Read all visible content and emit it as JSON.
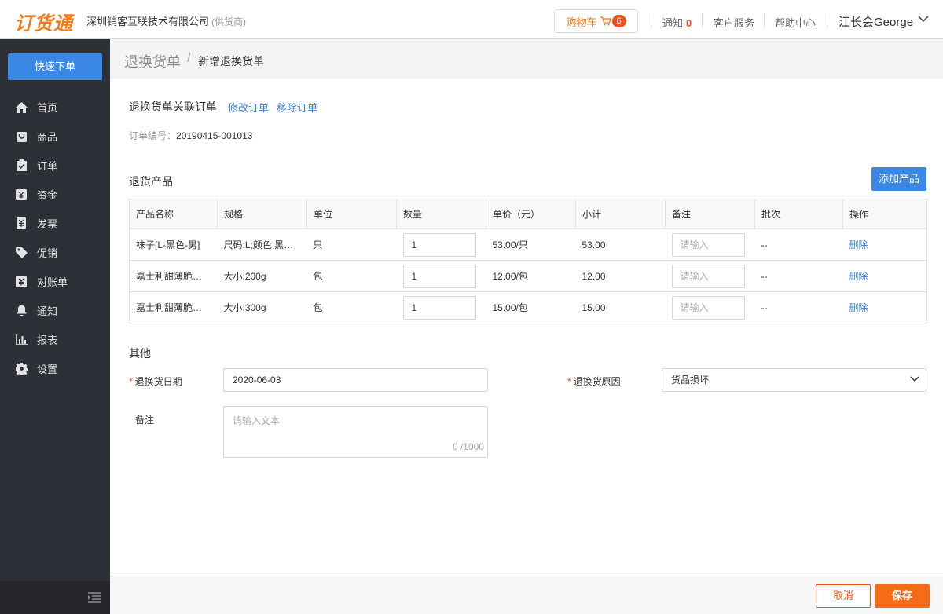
{
  "header": {
    "logo": "订货通",
    "company": "深圳销客互联技术有限公司",
    "role": "(供货商)",
    "cart_label": "购物车",
    "cart_count": "6",
    "notice_label": "通知",
    "notice_count": "0",
    "service_label": "客户服务",
    "help_label": "帮助中心",
    "user_name": "江长会George"
  },
  "sidebar": {
    "quick_order": "快速下单",
    "items": [
      {
        "label": "首页",
        "icon": "home-icon"
      },
      {
        "label": "商品",
        "icon": "product-icon"
      },
      {
        "label": "订单",
        "icon": "order-icon"
      },
      {
        "label": "资金",
        "icon": "funds-icon"
      },
      {
        "label": "发票",
        "icon": "invoice-icon"
      },
      {
        "label": "促销",
        "icon": "tag-icon"
      },
      {
        "label": "对账单",
        "icon": "statement-icon"
      },
      {
        "label": "通知",
        "icon": "bell-icon"
      },
      {
        "label": "报表",
        "icon": "chart-icon"
      },
      {
        "label": "设置",
        "icon": "gear-icon"
      }
    ]
  },
  "breadcrumb": {
    "parent": "退换货单",
    "current": "新增退换货单"
  },
  "linked_order": {
    "title": "退换货单关联订单",
    "modify_label": "修改订单",
    "remove_label": "移除订单",
    "order_no_label": "订单编号：",
    "order_no_value": "20190415-001013"
  },
  "products": {
    "title": "退货产品",
    "add_label": "添加产品",
    "columns": [
      "产品名称",
      "规格",
      "单位",
      "数量",
      "单价（元）",
      "小计",
      "备注",
      "批次",
      "操作"
    ],
    "note_placeholder": "请输入",
    "delete_label": "删除",
    "rows": [
      {
        "name": "袜子[L-黑色-男]",
        "spec": "尺码:L;颜色:黑色;性别:男",
        "unit": "只",
        "qty": "1",
        "price": "53.00/只",
        "subtotal": "53.00",
        "batch": "--"
      },
      {
        "name": "嘉士利甜薄脆饼干",
        "spec": "大小:200g",
        "unit": "包",
        "qty": "1",
        "price": "12.00/包",
        "subtotal": "12.00",
        "batch": "--"
      },
      {
        "name": "嘉士利甜薄脆饼干",
        "spec": "大小:300g",
        "unit": "包",
        "qty": "1",
        "price": "15.00/包",
        "subtotal": "15.00",
        "batch": "--"
      }
    ]
  },
  "other": {
    "title": "其他",
    "date_label": "退换货日期",
    "date_value": "2020-06-03",
    "reason_label": "退换货原因",
    "reason_value": "货品损坏",
    "remark_label": "备注",
    "remark_placeholder": "请输入文本",
    "remark_count": "0 /1000"
  },
  "footer": {
    "cancel_label": "取消",
    "save_label": "保存"
  },
  "colors": {
    "brand_orange": "#f07c1a",
    "primary_blue": "#3b87e6",
    "sidebar_bg": "#2d3037",
    "save_orange": "#f46d16"
  }
}
